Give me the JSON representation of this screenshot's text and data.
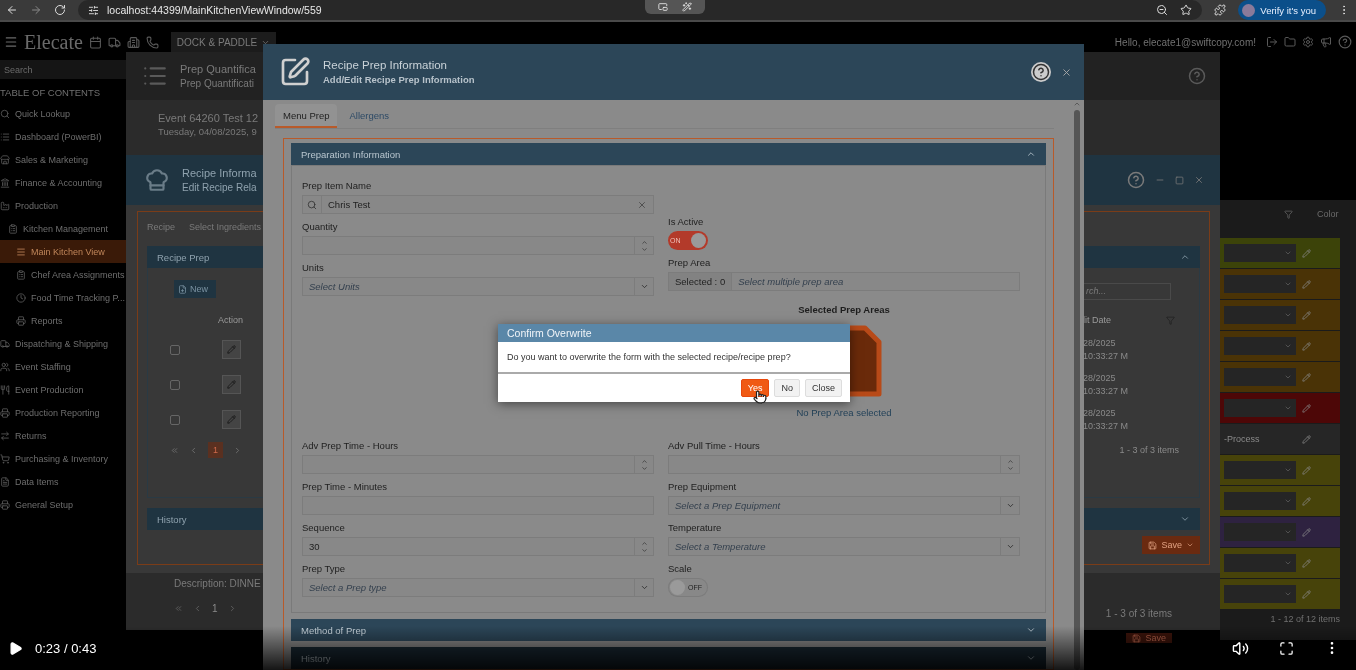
{
  "browser": {
    "url": "localhost:44399/MainKitchenViewWindow/559",
    "profile_button": "Verify it's you"
  },
  "app_header": {
    "brand": "Elecate",
    "location_dropdown": "DOCK & PADDLE",
    "greeting": "Hello, elecate1@swiftcopy.com!"
  },
  "sidebar": {
    "search_placeholder": "Search",
    "heading": "TABLE OF CONTENTS",
    "items": [
      {
        "label": "Quick Lookup",
        "selected": false
      },
      {
        "label": "Dashboard (PowerBI)",
        "selected": false
      },
      {
        "label": "Sales & Marketing",
        "selected": false
      },
      {
        "label": "Finance & Accounting",
        "selected": false
      },
      {
        "label": "Production",
        "selected": false,
        "children": [
          {
            "label": "Kitchen Management",
            "selected": false,
            "children": [
              {
                "label": "Main Kitchen View",
                "selected": true
              },
              {
                "label": "Chef Area Assignments",
                "selected": false
              },
              {
                "label": "Food Time Tracking P...",
                "selected": false
              },
              {
                "label": "Reports",
                "selected": false
              }
            ]
          }
        ]
      },
      {
        "label": "Dispatching & Shipping",
        "selected": false
      },
      {
        "label": "Event Staffing",
        "selected": false
      },
      {
        "label": "Event Production",
        "selected": false
      },
      {
        "label": "Production Reporting",
        "selected": false
      },
      {
        "label": "Returns",
        "selected": false
      },
      {
        "label": "Purchasing & Inventory",
        "selected": false
      },
      {
        "label": "Data Items",
        "selected": false
      },
      {
        "label": "General Setup",
        "selected": false
      }
    ]
  },
  "prep_quantification_window": {
    "title": "Prep Quantifica",
    "subtitle": "Prep Quantificati",
    "event": "Event 64260 Test 12",
    "date": "Tuesday, 04/08/2025, 9",
    "description": "Description: DINNE",
    "page": "1",
    "pager_count": "1 - 3 of 3 items",
    "save_button": "Save"
  },
  "recipe_window": {
    "title": "Recipe Informa",
    "subtitle": "Edit Recipe Rela",
    "breadcrumbs": [
      "Recipe",
      "Select Ingredients"
    ],
    "panel_title": "Recipe Prep",
    "new_button": "New",
    "action_column": "Action",
    "date_column": "lit Date",
    "search_placeholder": "rch...",
    "rows": [
      {
        "checked": false,
        "date": "28/2025 10:33:27 M"
      },
      {
        "checked": false,
        "date": "28/2025 10:33:27 M"
      },
      {
        "checked": false,
        "date": "28/2025 10:33:27 M"
      }
    ],
    "page": "1",
    "pager_count": "1 - 3 of 3 items",
    "history_title": "History",
    "save_button": "Save"
  },
  "right_panel": {
    "column_header": "Color",
    "rows": [
      {
        "color": "#3c4309"
      },
      {
        "color": "#4a3306"
      },
      {
        "color": "#4a3306"
      },
      {
        "color": "#4a3306"
      },
      {
        "color": "#4a3306"
      },
      {
        "color": "#4d0707"
      },
      {
        "color": "#262626",
        "text": "-Process"
      },
      {
        "color": "#47430a"
      },
      {
        "color": "#47430a"
      },
      {
        "color": "#2e2240"
      },
      {
        "color": "#47430a"
      },
      {
        "color": "#47430a"
      }
    ],
    "pager_count": "1 - 12 of 12 items"
  },
  "recipe_prep_dialog": {
    "title": "Recipe Prep Information",
    "subtitle": "Add/Edit Recipe Prep Information",
    "tabs": [
      {
        "label": "Menu Prep",
        "selected": true
      },
      {
        "label": "Allergens",
        "selected": false
      }
    ],
    "section_title": "Preparation Information",
    "top_left_fields": [
      {
        "label": "Prep Item Name",
        "kind": "search",
        "value": "Chris Test"
      },
      {
        "label": "Quantity",
        "kind": "number"
      },
      {
        "label": "Units",
        "kind": "select",
        "placeholder": "Select Units"
      }
    ],
    "top_right_fields": [
      {
        "label": "Is Active",
        "kind": "toggle",
        "on": true,
        "state_label": "ON"
      },
      {
        "label": "Prep Area",
        "kind": "multiselect",
        "count_label": "Selected : 0",
        "placeholder": "Select multiple prep area"
      }
    ],
    "selected_areas": {
      "title": "Selected Prep Areas",
      "empty_text": "No Prep Area selected"
    },
    "fields": [
      {
        "label": "Adv Prep Time - Hours",
        "kind": "number"
      },
      {
        "label": "Adv Pull Time - Hours",
        "kind": "number"
      },
      {
        "label": "Prep Time - Minutes",
        "kind": "text"
      },
      {
        "label": "Prep Equipment",
        "kind": "select",
        "placeholder": "Select a Prep Equipment"
      },
      {
        "label": "Sequence",
        "kind": "number",
        "value": "30"
      },
      {
        "label": "Temperature",
        "kind": "select",
        "placeholder": "Select a Temperature"
      },
      {
        "label": "Prep Type",
        "kind": "select",
        "placeholder": "Select a Prep type"
      },
      {
        "label": "Scale",
        "kind": "toggle",
        "on": false,
        "state_label": "OFF"
      }
    ],
    "collapsed_sections": [
      "Method of Prep",
      "History"
    ]
  },
  "confirm_dialog": {
    "title": "Confirm Overwrite",
    "message": "Do you want to overwrite the form with the selected recipe/recipe prep?",
    "buttons": [
      {
        "label": "Yes",
        "kind": "primary"
      },
      {
        "label": "No",
        "kind": "default"
      },
      {
        "label": "Close",
        "kind": "default"
      }
    ]
  },
  "video_player": {
    "time": "0:23 / 0:43"
  }
}
